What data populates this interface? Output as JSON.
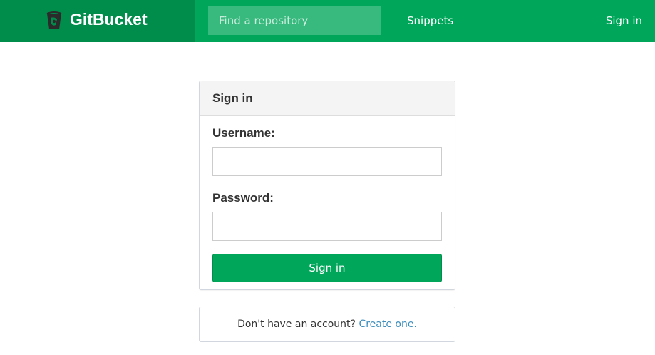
{
  "header": {
    "brand_name": "GitBucket",
    "logo_icon": "gitbucket-bucket-icon",
    "search": {
      "placeholder": "Find a repository",
      "value": ""
    },
    "nav": {
      "snippets_label": "Snippets",
      "signin_label": "Sign in"
    },
    "colors": {
      "bar": "#00a65a",
      "brand_bg": "#008d4c"
    }
  },
  "signin_form": {
    "title": "Sign in",
    "username_label": "Username:",
    "username_value": "",
    "password_label": "Password:",
    "password_value": "",
    "submit_label": "Sign in"
  },
  "register": {
    "prompt": "Don't have an account?",
    "link_label": "Create one."
  }
}
